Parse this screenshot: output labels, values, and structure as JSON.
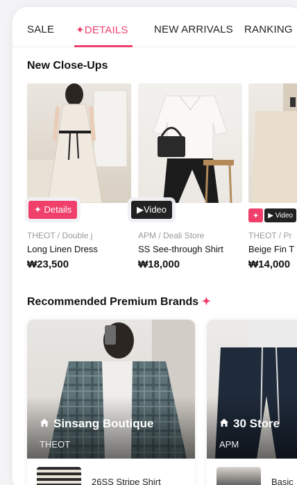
{
  "tabs": [
    {
      "label": "SALE"
    },
    {
      "label": "✦DETAILS",
      "active": true
    },
    {
      "label": "NEW ARRIVALS"
    },
    {
      "label": "RANKING"
    }
  ],
  "close_ups": {
    "title": "New Close-Ups",
    "products": [
      {
        "brand": "THEOT / Double j",
        "name": "Long Linen Dress",
        "price": "₩23,500",
        "badge": "✦ Details"
      },
      {
        "brand": "APM / Deali Store",
        "name": "SS See-through Shirt",
        "price": "₩18,000",
        "badge": "▶Video"
      },
      {
        "brand": "THEOT / Pr",
        "name": "Beige Fin T",
        "price": "₩14,000",
        "badge_a": "✦",
        "badge_b": "▶ Video"
      }
    ]
  },
  "brands": {
    "title": "Recommended Premium Brands",
    "title_mark": "✦",
    "cards": [
      {
        "name": "Sinsang Boutique",
        "sub": "THEOT",
        "item": "26SS Stripe Shirt"
      },
      {
        "name": "30 Store",
        "sub": "APM",
        "item": "Basic"
      }
    ]
  },
  "colors": {
    "accent": "#ef3f6a",
    "dark": "#222222"
  }
}
